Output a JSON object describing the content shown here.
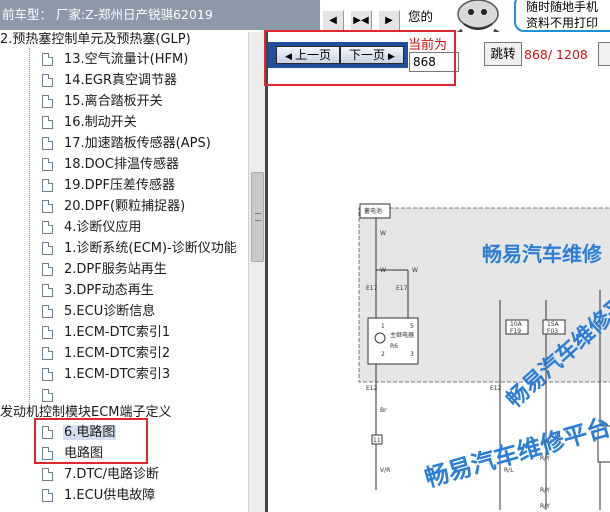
{
  "topbar": {
    "car_label": "前车型： 厂家:Z-郑州日产锐骐62019",
    "nav_buttons": [
      "◀",
      "▶◀",
      "▶"
    ],
    "ad_left_text": "您的",
    "ad_bubble_line1": "随时随地手机",
    "ad_bubble_line2": "资料不用打印"
  },
  "tree": {
    "parent_top": "2.预热塞控制单元及预热塞(GLP)",
    "items": [
      "13.空气流量计(HFM)",
      "14.EGR真空调节器",
      "15.离合踏板开关",
      "16.制动开关",
      "17.加速踏板传感器(APS)",
      "18.DOC排温传感器",
      "19.DPF压差传感器",
      "20.DPF(颗粒捕捉器)",
      "4.诊断仪应用",
      "1.诊断系统(ECM)-诊断仪功能",
      "2.DPF服务站再生",
      "3.DPF动态再生",
      "5.ECU诊断信息",
      "1.ECM-DTC索引1",
      "1.ECM-DTC索引2",
      "1.ECM-DTC索引3",
      ""
    ],
    "parent_bottom": "发动机控制模块ECM端子定义",
    "selected_items": [
      "6.电路图",
      "电路图"
    ],
    "after_items": [
      "7.DTC/电路诊断",
      "1.ECU供电故障"
    ]
  },
  "pager": {
    "prev_label": "上一页",
    "next_label": "下一页",
    "current_label": "当前为",
    "current_value": "868",
    "jump_label": "跳转",
    "page_count": "868/ 1208"
  },
  "diagram": {
    "battery_label": "蓄电池",
    "relay_label": "主继电器",
    "relay_code": "R6",
    "fuse1_rating": "10A",
    "fuse1_code": "F19",
    "fuse2_rating": "15A",
    "fuse2_code": "F03",
    "wire_labels": [
      "W",
      "W",
      "W",
      "Br",
      "V/R",
      "R/L",
      "R/Y",
      "R/Y",
      "R/Y"
    ],
    "connector_labels": [
      "E17",
      "E17",
      "E12",
      "E12",
      "E11",
      "F33"
    ],
    "pin_numbers": [
      "1",
      "2",
      "3",
      "5",
      "11"
    ],
    "watermark_top": "畅易汽车维修",
    "watermark_diag": "畅易汽车维修平台",
    "watermark_bottom": "畅易汽车维修平台"
  },
  "colors": {
    "accent_red": "#e0262f",
    "nav_blue": "#214f9e",
    "watermark_blue": "#2b7dd6"
  }
}
